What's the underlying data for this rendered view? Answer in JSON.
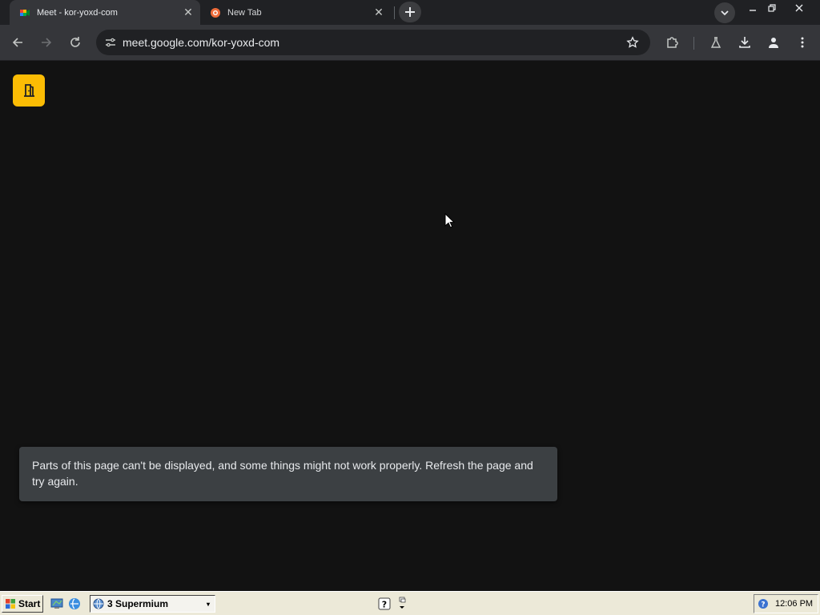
{
  "browser": {
    "tabs": [
      {
        "title": "Meet - kor-yoxd-com",
        "active": true,
        "favicon": "google-meet-icon"
      },
      {
        "title": "New Tab",
        "active": false,
        "favicon": "supermium-icon"
      }
    ],
    "address_bar": {
      "url": "meet.google.com/kor-yoxd-com"
    }
  },
  "page": {
    "leave_button_icon": "door-exit-icon",
    "toast_message": "Parts of this page can't be displayed, and some things might not work properly. Refresh the page and try again."
  },
  "taskbar": {
    "start_label": "Start",
    "task_label": "3 Supermium",
    "clock": "12:06 PM"
  },
  "colors": {
    "accent_yellow": "#fbbc04",
    "page_bg": "#121212",
    "toast_bg": "#3c4043",
    "toolbar_bg": "#35363a"
  }
}
